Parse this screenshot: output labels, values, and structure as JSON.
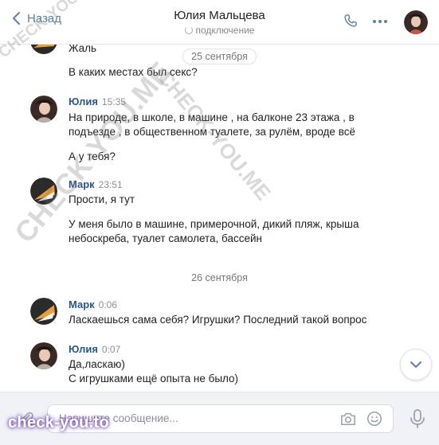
{
  "header": {
    "back_label": "Назад",
    "title": "Юлия Мальцева",
    "status": "подключение"
  },
  "feed": {
    "partial_message": "Жаль",
    "date_1": "25 сентября",
    "msg_question": "В каких местах был секс?",
    "block_yulia_1": {
      "sender": "Юлия",
      "time": "15:35",
      "line1": "На природе, в школе, в машине , на балконе 23 этажа , в",
      "line2": "подъезде , в общественном туалете, за рулём, вроде всё",
      "line3": "А у тебя?"
    },
    "block_mark_1": {
      "sender": "Марк",
      "time": "23:51",
      "line1": "Прости, я тут",
      "line2": "У меня было в машине, примерочной, дикий пляж, крыша",
      "line3": "небоскреба, туалет самолета, бассейн"
    },
    "date_2": "26 сентября",
    "block_mark_2": {
      "sender": "Марк",
      "time": "0:06",
      "line1": "Ласкаешься сама себя? Игрушки? Последний такой вопрос"
    },
    "block_yulia_2": {
      "sender": "Юлия",
      "time": "0:07",
      "line1": "Да,ласкаю)",
      "line2": "С игрушками ещё опыта не было)"
    }
  },
  "composer": {
    "placeholder": "Напишите сообщение..."
  },
  "watermarks": {
    "diag_1": "CHECK-YOU.ME",
    "diag_2": "CHECK-YOU.ME",
    "diag_3": "CHECK-YOU.ME",
    "logo": "check-you.to"
  },
  "colors": {
    "accent": "#2a5885",
    "link": "#5f7f9e",
    "composer_bg": "#f0f2f5"
  },
  "icons": [
    "chevron-left-icon",
    "phone-icon",
    "more-icon",
    "chevron-down-icon",
    "attach-icon",
    "camera-icon",
    "emoji-icon",
    "mic-icon"
  ]
}
